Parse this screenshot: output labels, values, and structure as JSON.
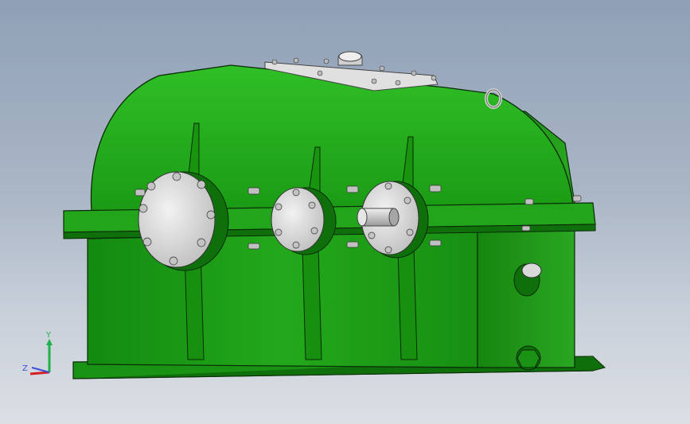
{
  "viewport": {
    "background_top": "#8fa0b6",
    "background_bottom": "#dcdfe4"
  },
  "model": {
    "body_color": "#1f9a17",
    "body_dark": "#106e0c",
    "body_light": "#33c02a",
    "cover_color": "#d8d8d8",
    "bolt_color": "#b9b9b9",
    "outline_color": "#0a2a08"
  },
  "triad": {
    "y_label": "Y",
    "z_label": "Z",
    "y_color": "#21b14a",
    "z_color": "#3b4fd8",
    "x_color": "#d42020"
  }
}
